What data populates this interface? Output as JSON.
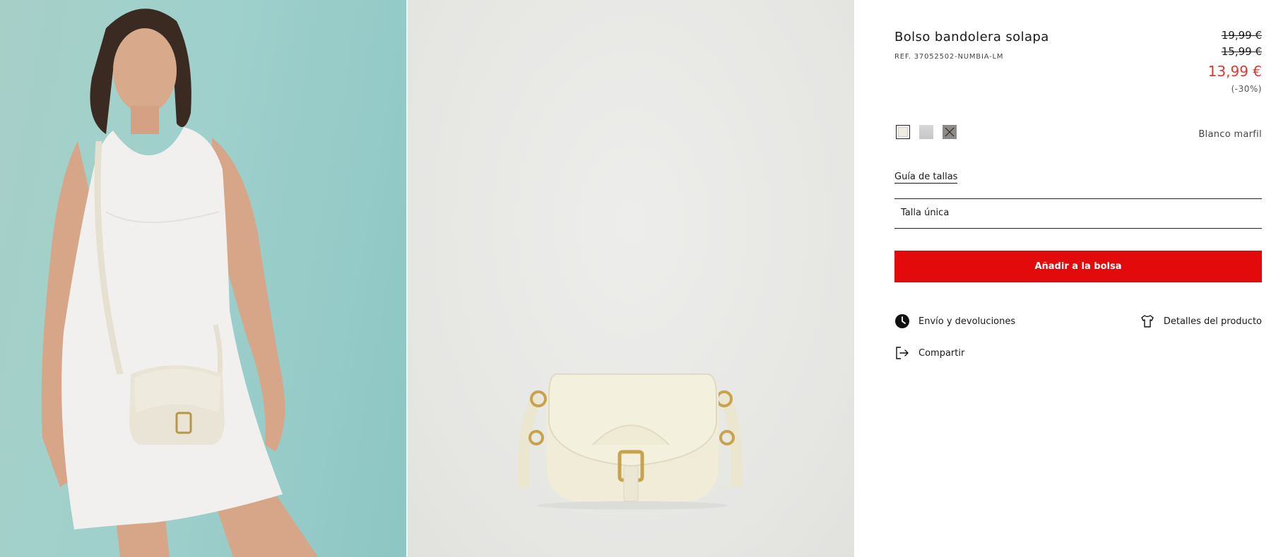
{
  "gallery": {
    "images": [
      {
        "alt_icon": "model-photo"
      },
      {
        "alt_icon": "bag-photo"
      }
    ]
  },
  "product": {
    "title": "Bolso bandolera solapa",
    "ref": "REF. 37052502-NUMBIA-LM",
    "prices": {
      "original": "19,99 €",
      "previous": "15,99 €",
      "current": "13,99 €",
      "discount": "(-30%)"
    },
    "colors": {
      "swatches": [
        "#efece1",
        "#cfcfcf",
        "#8c8986"
      ],
      "selected_index": 0,
      "selected_name": "Blanco marfil"
    },
    "size_guide_label": "Guía de tallas",
    "size_value": "Talla única",
    "add_to_bag_label": "Añadir a la bolsa",
    "actions": {
      "shipping": "Envío y devoluciones",
      "details": "Detalles del producto",
      "share": "Compartir"
    }
  },
  "colors": {
    "accent_red": "#e20a0a",
    "sale_price": "#e2372e"
  }
}
